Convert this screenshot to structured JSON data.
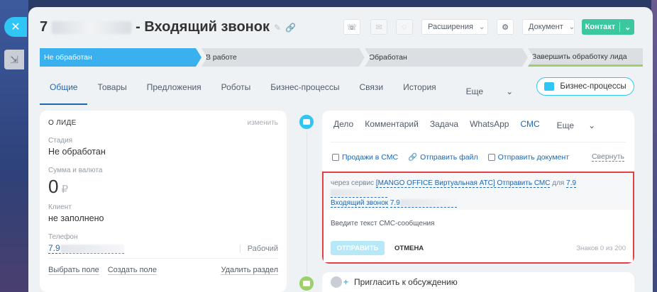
{
  "header": {
    "title_prefix": "7",
    "title_suffix": "- Входящий звонок"
  },
  "toolbar": {
    "extensions_label": "Расширения",
    "document_label": "Документ",
    "contact_label": "Контакт"
  },
  "stages": [
    {
      "label": "Не обработан"
    },
    {
      "label": "В работе"
    },
    {
      "label": "Обработан"
    },
    {
      "label": "Завершить обработку лида"
    }
  ],
  "tabs": [
    "Общие",
    "Товары",
    "Предложения",
    "Роботы",
    "Бизнес-процессы",
    "Связи",
    "История",
    "Еще"
  ],
  "bp_button": "Бизнес-процессы",
  "lead_card": {
    "title": "О ЛИДЕ",
    "edit": "изменить",
    "stage_label": "Стадия",
    "stage_value": "Не обработан",
    "amount_label": "Сумма и валюта",
    "amount_value": "0",
    "currency": "₽",
    "client_label": "Клиент",
    "client_value": "не заполнено",
    "phone_label": "Телефон",
    "phone_prefix": "7.9",
    "phone_type": "Рабочий",
    "select_field": "Выбрать поле",
    "create_field": "Создать поле",
    "delete_section": "Удалить раздел"
  },
  "activity": {
    "tabs": [
      "Дело",
      "Комментарий",
      "Задача",
      "WhatsApp",
      "СМС",
      "Еще"
    ],
    "actions": [
      "Продажи в СМС",
      "Отправить файл",
      "Отправить документ"
    ],
    "collapse": "Свернуть",
    "via_prefix": "через сервис",
    "via_service": "[MANGO OFFICE Виртуальная АТС] Отправить СМС",
    "via_for": "для",
    "via_recipient": "7.9",
    "via_call": "Входящий звонок",
    "via_call_phone": "7.9",
    "input_placeholder": "Введите текст СМС-сообщения",
    "send": "ОТПРАВИТЬ",
    "cancel": "ОТМЕНА",
    "counter": "Знаков 0 из 200"
  },
  "invite": "Пригласить к обсуждению",
  "colors": {
    "accent": "#2fc6f6",
    "stage_active": "#3bb0ef",
    "contact_green": "#3bc8a0",
    "highlight_red": "#e53f45",
    "timeline_sms": "#2fc6f6",
    "timeline_chat": "#9bd06a"
  }
}
